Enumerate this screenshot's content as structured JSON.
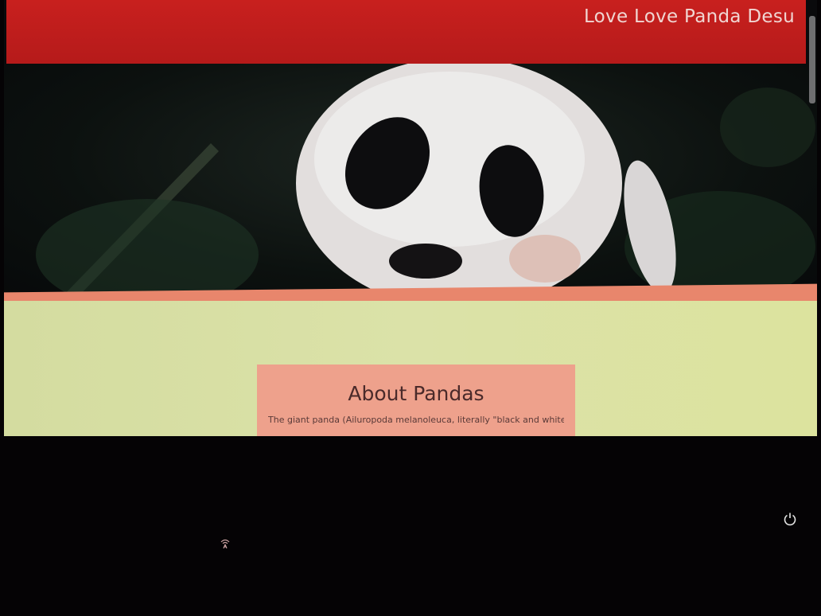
{
  "header": {
    "site_title": "Love Love Panda Desu",
    "background_color": "#c21f1d"
  },
  "hero": {
    "image_subject": "panda"
  },
  "about": {
    "title": "About Pandas",
    "text": "The giant panda (Ailuropoda melanoleuca, literally \"black and white"
  },
  "colors": {
    "accent_strip": "#e8866c",
    "section_background": "#d8e0a2",
    "card_background": "#eea18c"
  },
  "icons": {
    "power": "power-icon",
    "wifi": "wifi-icon"
  }
}
